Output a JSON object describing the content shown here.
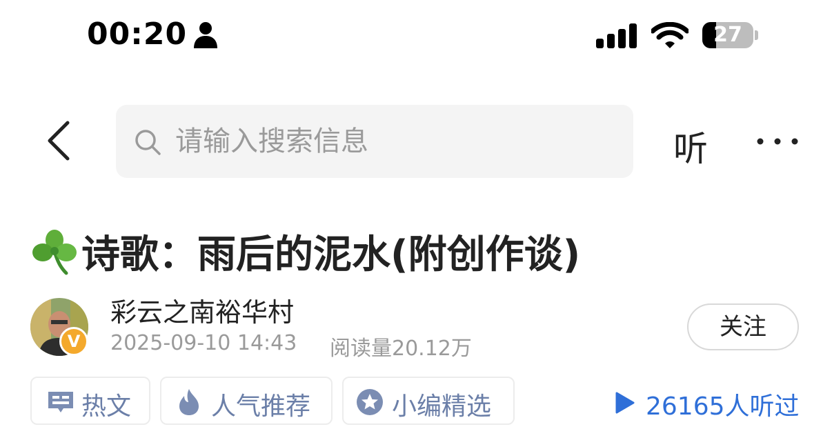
{
  "status_bar": {
    "time": "00:20",
    "battery": "27",
    "battery_level": 0.27,
    "icons": [
      "person-icon",
      "cellular-signal-icon",
      "wifi-icon",
      "battery-icon"
    ]
  },
  "nav": {
    "search_placeholder": "请输入搜索信息",
    "listen_label": "听",
    "icons": [
      "back-chevron-icon",
      "search-icon",
      "more-dots-icon"
    ]
  },
  "article": {
    "title": "诗歌：雨后的泥水(附创作谈)",
    "title_emoji": "clover-icon",
    "author": "彩云之南裕华村",
    "badge": "V",
    "date": "2025-09-10 14:43",
    "read_count": "阅读量20.12万",
    "follow_label": "关注"
  },
  "tags": [
    {
      "label": "热文",
      "icon": "hot-article-icon"
    },
    {
      "label": "人气推荐",
      "icon": "flame-icon"
    },
    {
      "label": "小编精选",
      "icon": "star-badge-icon"
    }
  ],
  "listened": {
    "label": "26165人听过",
    "icon": "play-icon"
  },
  "colors": {
    "tag_text": "#6b7fa8",
    "link_blue": "#2f6fd8",
    "muted": "#9a9a9a",
    "badge_orange": "#f4a92c",
    "search_bg": "#f4f4f4"
  }
}
